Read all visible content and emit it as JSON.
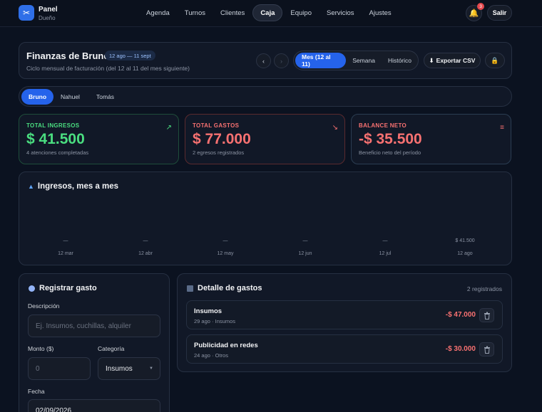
{
  "topbar": {
    "logo_icon": "scissors-icon",
    "brand_title": "Panel",
    "brand_subtitle": "Dueño",
    "nav": [
      "Agenda",
      "Turnos",
      "Clientes",
      "Caja",
      "Equipo",
      "Servicios",
      "Ajustes"
    ],
    "active_nav": "Caja",
    "notifications_count": "3",
    "logout_label": "Salir"
  },
  "header": {
    "title": "Finanzas de Bruno",
    "period_badge": "12 ago — 11 sept",
    "subtitle": "Ciclo mensual de facturación (del 12 al 11 del mes siguiente)",
    "prev_label": "‹",
    "next_label": "›",
    "periods": [
      "Mes (12 al 11)",
      "Semana",
      "Histórico"
    ],
    "active_period": "Mes (12 al 11)",
    "export_label": "Exportar CSV"
  },
  "people": {
    "tabs": [
      "Bruno",
      "Nahuel",
      "Tomás"
    ],
    "active": "Bruno"
  },
  "kpis": {
    "income": {
      "label": "TOTAL INGRESOS",
      "value": "$ 41.500",
      "sub": "4 atenciones completadas"
    },
    "expenses": {
      "label": "TOTAL GASTOS",
      "value": "$ 77.000",
      "sub": "2 egresos registrados"
    },
    "balance": {
      "label": "BALANCE NETO",
      "value": "-$ 35.500",
      "sub": "Beneficio neto del período"
    },
    "colors": {
      "income": "#4ade80",
      "expenses": "#f87171",
      "balance": "#f87171"
    }
  },
  "chart_data": {
    "type": "bar",
    "title": "Ingresos, mes a mes",
    "categories": [
      "12 mar",
      "12 abr",
      "12 may",
      "12 jun",
      "12 jul",
      "12 ago"
    ],
    "values": [
      null,
      null,
      null,
      null,
      null,
      41500
    ],
    "data_labels": [
      "—",
      "—",
      "—",
      "—",
      "—",
      "$ 41.500"
    ]
  },
  "register": {
    "title": "Registrar gasto",
    "description_label": "Descripción",
    "description_placeholder": "Ej. Insumos, cuchillas, alquiler",
    "amount_label": "Monto ($)",
    "amount_placeholder": "0",
    "category_label": "Categoría",
    "category_value": "Insumos",
    "date_label": "Fecha",
    "date_value": "02/09/2026"
  },
  "details": {
    "title": "Detalle de gastos",
    "count": "2 registrados",
    "items": [
      {
        "name": "Insumos",
        "meta": "29 ago · Insumos",
        "amount": "-$ 47.000"
      },
      {
        "name": "Publicidad en redes",
        "meta": "24 ago · Otros",
        "amount": "-$ 30.000"
      }
    ]
  }
}
